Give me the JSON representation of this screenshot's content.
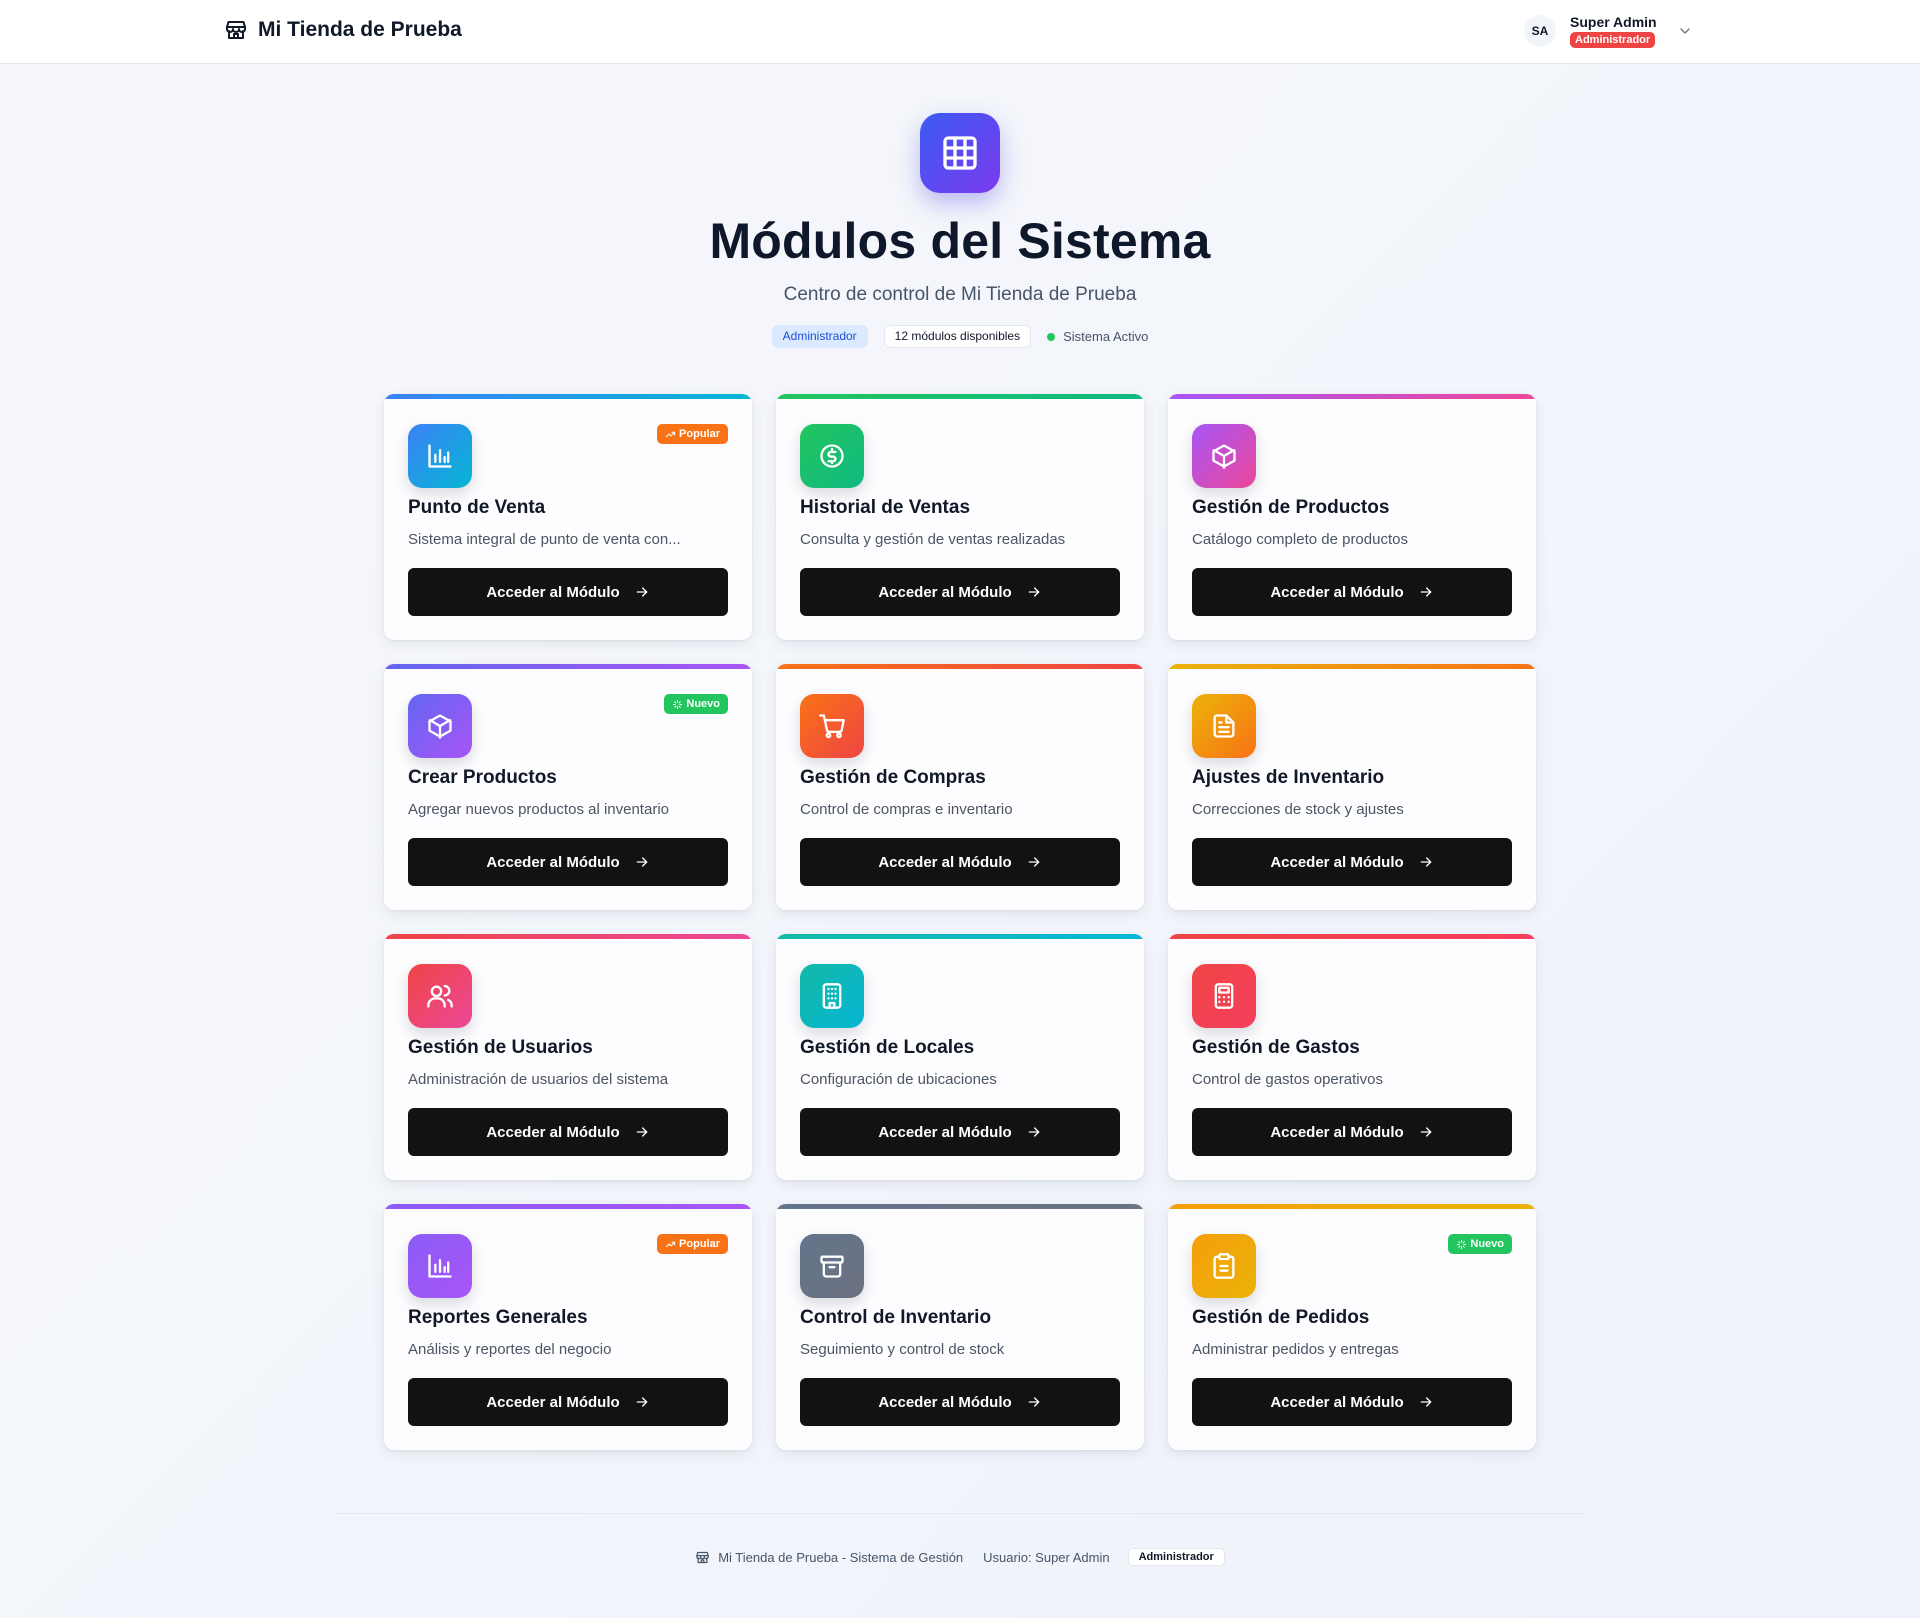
{
  "header": {
    "store_name": "Mi Tienda de Prueba",
    "user_initials": "SA",
    "user_name": "Super Admin",
    "user_role": "Administrador"
  },
  "hero": {
    "title": "Módulos del Sistema",
    "subtitle": "Centro de control de Mi Tienda de Prueba",
    "role_badge": "Administrador",
    "modules_badge": "12 módulos disponibles",
    "status": "Sistema Activo"
  },
  "button_label": "Acceder al Módulo",
  "modules": [
    {
      "title": "Punto de Venta",
      "desc": "Sistema integral de punto de venta con...",
      "badge": "Popular",
      "badge_color": "#f97316",
      "icon": "bar-chart-icon",
      "colors": [
        "#3b82f6",
        "#06b6d4"
      ]
    },
    {
      "title": "Historial de Ventas",
      "desc": "Consulta y gestión de ventas realizadas",
      "badge": "",
      "icon": "dollar-circle-icon",
      "colors": [
        "#22c55e",
        "#10b981"
      ]
    },
    {
      "title": "Gestión de Productos",
      "desc": "Catálogo completo de productos",
      "badge": "",
      "icon": "package-icon",
      "colors": [
        "#a855f7",
        "#ec4899"
      ]
    },
    {
      "title": "Crear Productos",
      "desc": "Agregar nuevos productos al inventario",
      "badge": "Nuevo",
      "badge_color": "#22c55e",
      "icon": "package-icon",
      "colors": [
        "#6366f1",
        "#a855f7"
      ]
    },
    {
      "title": "Gestión de Compras",
      "desc": "Control de compras e inventario",
      "badge": "",
      "icon": "shopping-cart-icon",
      "colors": [
        "#f97316",
        "#ef4444"
      ]
    },
    {
      "title": "Ajustes de Inventario",
      "desc": "Correcciones de stock y ajustes",
      "badge": "",
      "icon": "file-text-icon",
      "colors": [
        "#eab308",
        "#f97316"
      ]
    },
    {
      "title": "Gestión de Usuarios",
      "desc": "Administración de usuarios del sistema",
      "badge": "",
      "icon": "users-icon",
      "colors": [
        "#ef4444",
        "#ec4899"
      ]
    },
    {
      "title": "Gestión de Locales",
      "desc": "Configuración de ubicaciones",
      "badge": "",
      "icon": "building-icon",
      "colors": [
        "#14b8a6",
        "#06b6d4"
      ]
    },
    {
      "title": "Gestión de Gastos",
      "desc": "Control de gastos operativos",
      "badge": "",
      "icon": "calculator-icon",
      "colors": [
        "#ef4444",
        "#f43f5e"
      ]
    },
    {
      "title": "Reportes Generales",
      "desc": "Análisis y reportes del negocio",
      "badge": "Popular",
      "badge_color": "#f97316",
      "icon": "bar-chart-icon",
      "colors": [
        "#8b5cf6",
        "#a855f7"
      ]
    },
    {
      "title": "Control de Inventario",
      "desc": "Seguimiento y control de stock",
      "badge": "",
      "icon": "archive-icon",
      "colors": [
        "#64748b",
        "#6b7280"
      ]
    },
    {
      "title": "Gestión de Pedidos",
      "desc": "Administrar pedidos y entregas",
      "badge": "Nuevo",
      "badge_color": "#22c55e",
      "icon": "clipboard-icon",
      "colors": [
        "#f59e0b",
        "#eab308"
      ]
    }
  ],
  "footer": {
    "system": "Mi Tienda de Prueba - Sistema de Gestión",
    "user": "Usuario: Super Admin",
    "role": "Administrador"
  }
}
